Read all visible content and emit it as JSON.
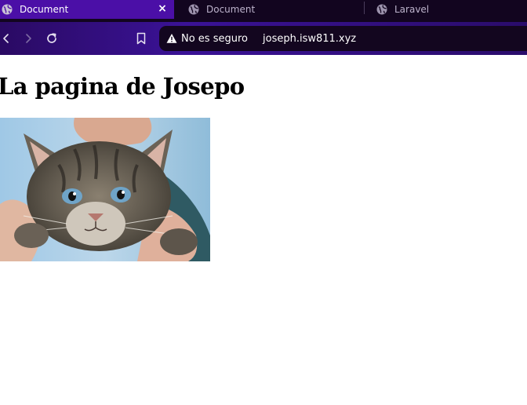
{
  "browser": {
    "tabs": [
      {
        "title": "Document",
        "active": true,
        "icon": "globe-icon"
      },
      {
        "title": "Document",
        "active": false,
        "icon": "globe-icon"
      },
      {
        "title": "Laravel",
        "active": false,
        "icon": "globe-icon"
      }
    ],
    "close_icon": "×",
    "toolbar": {
      "back_icon": "chevron-left-icon",
      "forward_icon": "chevron-right-icon",
      "reload_icon": "reload-icon",
      "bookmark_icon": "bookmark-icon"
    },
    "address_bar": {
      "security_icon": "warning-icon",
      "security_label": "No es seguro",
      "url": "joseph.isw811.xyz"
    },
    "colors": {
      "tab_strip": "#12051f",
      "active_tab": "#4b0fa7",
      "toolbar": "#3a1296",
      "omnibox": "#13061f"
    }
  },
  "page": {
    "heading": "La pagina de Josepo",
    "image": {
      "subject": "kitten-photo"
    }
  }
}
